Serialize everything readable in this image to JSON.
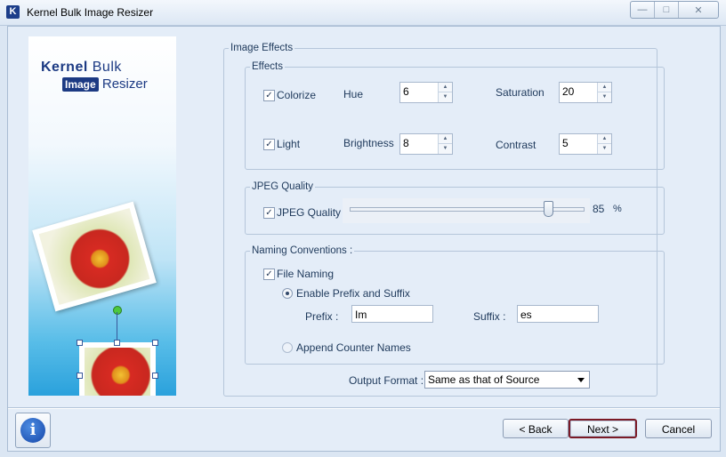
{
  "window": {
    "title": "Kernel Bulk Image Resizer",
    "icon_letter": "K"
  },
  "banner": {
    "logo_kernel": "Kernel",
    "logo_bulk": "Bulk",
    "logo_image": "Image",
    "logo_resizer": "Resizer"
  },
  "image_effects": {
    "legend": "Image Effects",
    "effects": {
      "legend": "Effects",
      "colorize": {
        "label": "Colorize",
        "checked": true
      },
      "hue": {
        "label": "Hue",
        "value": "6"
      },
      "saturation": {
        "label": "Saturation",
        "value": "20"
      },
      "light": {
        "label": "Light",
        "checked": true
      },
      "brightness": {
        "label": "Brightness",
        "value": "8"
      },
      "contrast": {
        "label": "Contrast",
        "value": "5"
      }
    },
    "jpeg": {
      "legend": "JPEG Quality",
      "label": "JPEG Quality :",
      "checked": true,
      "value": "85",
      "unit": "%",
      "slider_fraction": 0.85
    },
    "naming": {
      "legend": "Naming Conventions :",
      "file_naming": {
        "label": "File Naming",
        "checked": true
      },
      "enable_prefix_suffix": {
        "label": "Enable Prefix and Suffix",
        "selected": true
      },
      "prefix": {
        "label": "Prefix :",
        "value": "Im"
      },
      "suffix": {
        "label": "Suffix :",
        "value": "es"
      },
      "append_counter": {
        "label": "Append Counter Names",
        "selected": false
      }
    },
    "output_format": {
      "label": "Output Format :",
      "value": "Same as that of Source"
    }
  },
  "footer": {
    "back_label": "< Back",
    "next_label": "Next >",
    "cancel_label": "Cancel"
  },
  "colors": {
    "focus_border": "#7b1a26",
    "accent": "#1c3a83"
  }
}
